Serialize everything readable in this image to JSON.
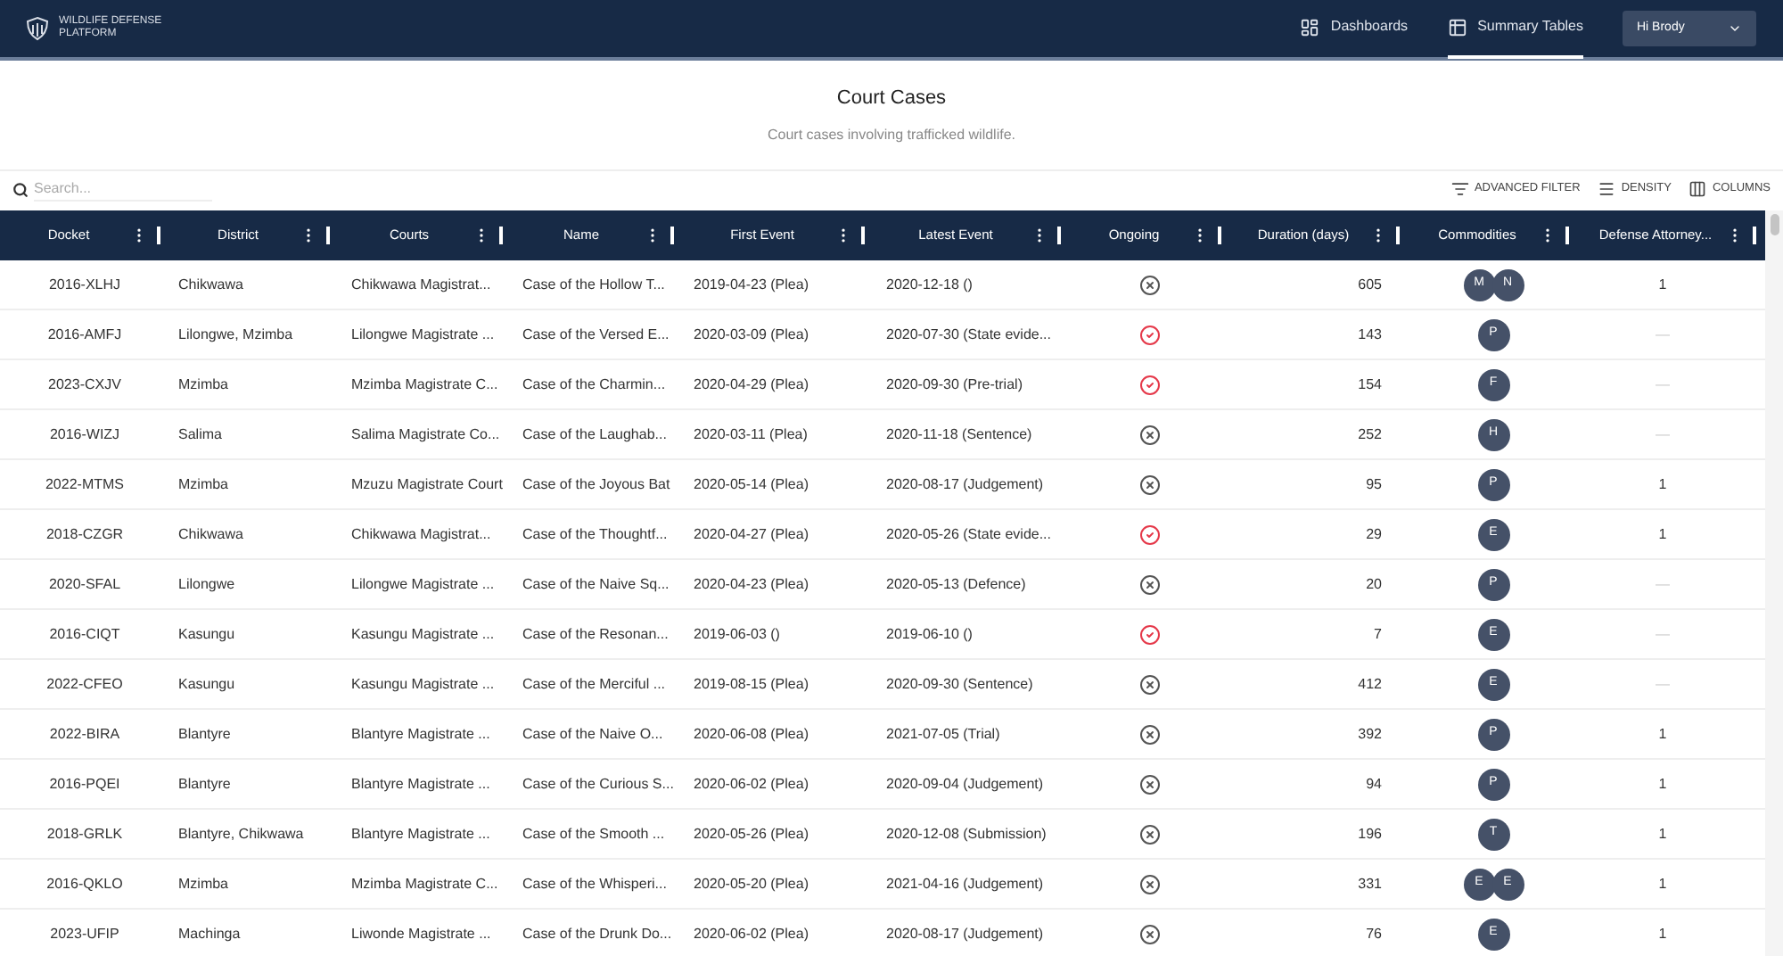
{
  "brand": {
    "line_1": "WILDLIFE DEFENSE",
    "line_2": "PLATFORM"
  },
  "nav": [
    {
      "label": "Dashboards",
      "kind": "dashboard",
      "selected": false
    },
    {
      "label": "Summary Tables",
      "kind": "table",
      "selected": true
    }
  ],
  "user_menu": {
    "label": "Hi Brody"
  },
  "page": {
    "title": "Court Cases",
    "subtitle": "Court cases involving trafficked wildlife."
  },
  "search": {
    "placeholder": "Search..."
  },
  "toolbar": [
    {
      "label": "ADVANCED FILTER",
      "kind": "filter"
    },
    {
      "label": "DENSITY",
      "kind": "density"
    },
    {
      "label": "COLUMNS",
      "kind": "columns"
    }
  ],
  "table": {
    "columns": [
      "Docket",
      "District",
      "Courts",
      "Name",
      "First Event",
      "Latest Event",
      "Ongoing",
      "Duration (days)",
      "Commodities",
      "Defense Attorney..."
    ],
    "rows": [
      {
        "docket": "2016-XLHJ",
        "district": "Chikwawa",
        "courts": "Chikwawa Magistrat...",
        "name": "Case of the Hollow T...",
        "first_event": "2019-04-23 (Plea)",
        "latest_event": "2020-12-18 ()",
        "ongoing": false,
        "duration": "605",
        "commodities": [
          "M",
          "N"
        ],
        "defense_attorney": "1"
      },
      {
        "docket": "2016-AMFJ",
        "district": "Lilongwe, Mzimba",
        "courts": "Lilongwe Magistrate ...",
        "name": "Case of the Versed E...",
        "first_event": "2020-03-09 (Plea)",
        "latest_event": "2020-07-30 (State evide...",
        "ongoing": true,
        "duration": "143",
        "commodities": [
          "P"
        ],
        "defense_attorney": "—"
      },
      {
        "docket": "2023-CXJV",
        "district": "Mzimba",
        "courts": "Mzimba Magistrate C...",
        "name": "Case of the Charmin...",
        "first_event": "2020-04-29 (Plea)",
        "latest_event": "2020-09-30 (Pre-trial)",
        "ongoing": true,
        "duration": "154",
        "commodities": [
          "F"
        ],
        "defense_attorney": "—"
      },
      {
        "docket": "2016-WIZJ",
        "district": "Salima",
        "courts": "Salima Magistrate Co...",
        "name": "Case of the Laughab...",
        "first_event": "2020-03-11 (Plea)",
        "latest_event": "2020-11-18 (Sentence)",
        "ongoing": false,
        "duration": "252",
        "commodities": [
          "H"
        ],
        "defense_attorney": "—"
      },
      {
        "docket": "2022-MTMS",
        "district": "Mzimba",
        "courts": "Mzuzu Magistrate Court",
        "name": "Case of the Joyous Bat",
        "first_event": "2020-05-14 (Plea)",
        "latest_event": "2020-08-17 (Judgement)",
        "ongoing": false,
        "duration": "95",
        "commodities": [
          "P"
        ],
        "defense_attorney": "1"
      },
      {
        "docket": "2018-CZGR",
        "district": "Chikwawa",
        "courts": "Chikwawa Magistrat...",
        "name": "Case of the Thoughtf...",
        "first_event": "2020-04-27 (Plea)",
        "latest_event": "2020-05-26 (State evide...",
        "ongoing": true,
        "duration": "29",
        "commodities": [
          "E"
        ],
        "defense_attorney": "1"
      },
      {
        "docket": "2020-SFAL",
        "district": "Lilongwe",
        "courts": "Lilongwe Magistrate ...",
        "name": "Case of the Naive Sq...",
        "first_event": "2020-04-23 (Plea)",
        "latest_event": "2020-05-13 (Defence)",
        "ongoing": false,
        "duration": "20",
        "commodities": [
          "P"
        ],
        "defense_attorney": "—"
      },
      {
        "docket": "2016-CIQT",
        "district": "Kasungu",
        "courts": "Kasungu Magistrate ...",
        "name": "Case of the Resonan...",
        "first_event": "2019-06-03 ()",
        "latest_event": "2019-06-10 ()",
        "ongoing": true,
        "duration": "7",
        "commodities": [
          "E"
        ],
        "defense_attorney": "—"
      },
      {
        "docket": "2022-CFEO",
        "district": "Kasungu",
        "courts": "Kasungu Magistrate ...",
        "name": "Case of the Merciful ...",
        "first_event": "2019-08-15 (Plea)",
        "latest_event": "2020-09-30 (Sentence)",
        "ongoing": false,
        "duration": "412",
        "commodities": [
          "E"
        ],
        "defense_attorney": "—"
      },
      {
        "docket": "2022-BIRA",
        "district": "Blantyre",
        "courts": "Blantyre Magistrate ...",
        "name": "Case of the Naive O...",
        "first_event": "2020-06-08 (Plea)",
        "latest_event": "2021-07-05 (Trial)",
        "ongoing": false,
        "duration": "392",
        "commodities": [
          "P"
        ],
        "defense_attorney": "1"
      },
      {
        "docket": "2016-PQEI",
        "district": "Blantyre",
        "courts": "Blantyre Magistrate ...",
        "name": "Case of the Curious S...",
        "first_event": "2020-06-02 (Plea)",
        "latest_event": "2020-09-04 (Judgement)",
        "ongoing": false,
        "duration": "94",
        "commodities": [
          "P"
        ],
        "defense_attorney": "1"
      },
      {
        "docket": "2018-GRLK",
        "district": "Blantyre, Chikwawa",
        "courts": "Blantyre Magistrate ...",
        "name": "Case of the Smooth ...",
        "first_event": "2020-05-26 (Plea)",
        "latest_event": "2020-12-08 (Submission)",
        "ongoing": false,
        "duration": "196",
        "commodities": [
          "T"
        ],
        "defense_attorney": "1"
      },
      {
        "docket": "2016-QKLO",
        "district": "Mzimba",
        "courts": "Mzimba Magistrate C...",
        "name": "Case of the Whisperi...",
        "first_event": "2020-05-20 (Plea)",
        "latest_event": "2021-04-16 (Judgement)",
        "ongoing": false,
        "duration": "331",
        "commodities": [
          "E",
          "E"
        ],
        "defense_attorney": "1"
      },
      {
        "docket": "2023-UFIP",
        "district": "Machinga",
        "courts": "Liwonde Magistrate ...",
        "name": "Case of the Drunk Do...",
        "first_event": "2020-06-02 (Plea)",
        "latest_event": "2020-08-17 (Judgement)",
        "ongoing": false,
        "duration": "76",
        "commodities": [
          "E"
        ],
        "defense_attorney": "1"
      }
    ]
  }
}
